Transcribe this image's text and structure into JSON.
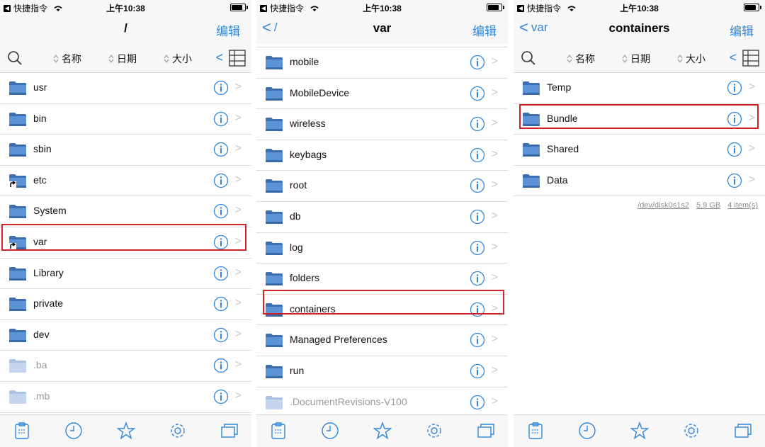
{
  "colors": {
    "accent": "#2f86d8",
    "highlight": "#d1232a",
    "folder": "#4c82c4"
  },
  "status": {
    "app": "快捷指令",
    "time": "上午10:38",
    "battery_percent": 90
  },
  "edit_label": "编辑",
  "sort": {
    "name": "名称",
    "date": "日期",
    "size": "大小"
  },
  "panel1": {
    "title": "/",
    "rows": [
      {
        "label": "usr"
      },
      {
        "label": "bin"
      },
      {
        "label": "sbin"
      },
      {
        "label": "etc"
      },
      {
        "label": "System"
      },
      {
        "label": "var"
      },
      {
        "label": "Library"
      },
      {
        "label": "private"
      },
      {
        "label": "dev"
      },
      {
        "label": ".ba"
      },
      {
        "label": ".mb"
      }
    ]
  },
  "panel2": {
    "back": "/",
    "title": "var",
    "rows": [
      {
        "label": "mobile"
      },
      {
        "label": "MobileDevice"
      },
      {
        "label": "wireless"
      },
      {
        "label": "keybags"
      },
      {
        "label": "root"
      },
      {
        "label": "db"
      },
      {
        "label": "log"
      },
      {
        "label": "folders"
      },
      {
        "label": "containers"
      },
      {
        "label": "Managed Preferences"
      },
      {
        "label": "run"
      },
      {
        "label": ".DocumentRevisions-V100"
      }
    ]
  },
  "panel3": {
    "back": "var",
    "title": "containers",
    "rows": [
      {
        "label": "Temp"
      },
      {
        "label": "Bundle"
      },
      {
        "label": "Shared"
      },
      {
        "label": "Data"
      }
    ],
    "footer": {
      "disk": "/dev/disk0s1s2",
      "size": "5.9 GB",
      "count": "4 item(s)"
    }
  },
  "tabs": [
    "clipboard-icon",
    "clock-icon",
    "star-icon",
    "gear-icon",
    "windows-icon"
  ]
}
